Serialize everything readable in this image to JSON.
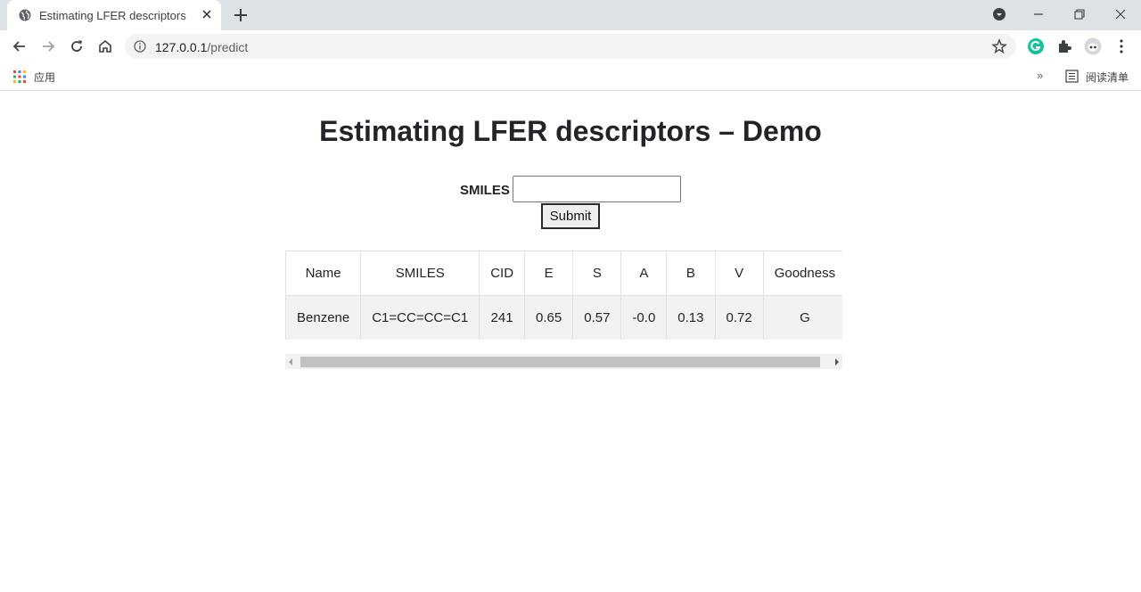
{
  "browser": {
    "tab_title": "Estimating LFER descriptors",
    "url_host": "127.0.0.1",
    "url_path": "/predict",
    "bookmarks": {
      "apps_label": "应用",
      "more": "»",
      "reading_list_label": "阅读清单"
    }
  },
  "page": {
    "heading": "Estimating LFER descriptors – Demo",
    "form": {
      "label": "SMILES",
      "input_value": "",
      "submit_label": "Submit"
    },
    "table": {
      "headers": [
        "Name",
        "SMILES",
        "CID",
        "E",
        "S",
        "A",
        "B",
        "V",
        "Goodness"
      ],
      "rows": [
        [
          "Benzene",
          "C1=CC=CC=C1",
          "241",
          "0.65",
          "0.57",
          "-0.0",
          "0.13",
          "0.72",
          "G"
        ]
      ]
    }
  },
  "colors": {
    "heading": "#212529",
    "table_row_bg": "#f2f2f2",
    "tabbar_bg": "#dee1e6",
    "omnibox_bg": "#f1f3f4"
  }
}
